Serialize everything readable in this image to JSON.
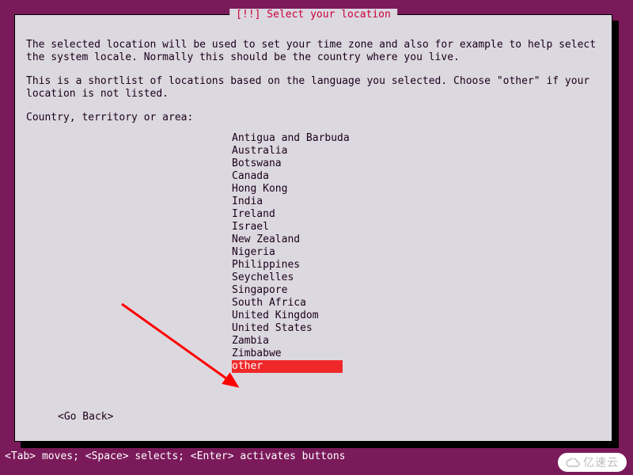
{
  "title": "[!!] Select your location",
  "paragraphs": {
    "p1": "The selected location will be used to set your time zone and also for example to help select the system locale. Normally this should be the country where you live.",
    "p2": "This is a shortlist of locations based on the language you selected. Choose \"other\" if your location is not listed.",
    "prompt": "Country, territory or area:"
  },
  "items": [
    "Antigua and Barbuda",
    "Australia",
    "Botswana",
    "Canada",
    "Hong Kong",
    "India",
    "Ireland",
    "Israel",
    "New Zealand",
    "Nigeria",
    "Philippines",
    "Seychelles",
    "Singapore",
    "South Africa",
    "United Kingdom",
    "United States",
    "Zambia",
    "Zimbabwe",
    "other"
  ],
  "selected_index": 18,
  "go_back": "<Go Back>",
  "helpbar": "<Tab> moves; <Space> selects; <Enter> activates buttons",
  "watermark": "亿速云"
}
